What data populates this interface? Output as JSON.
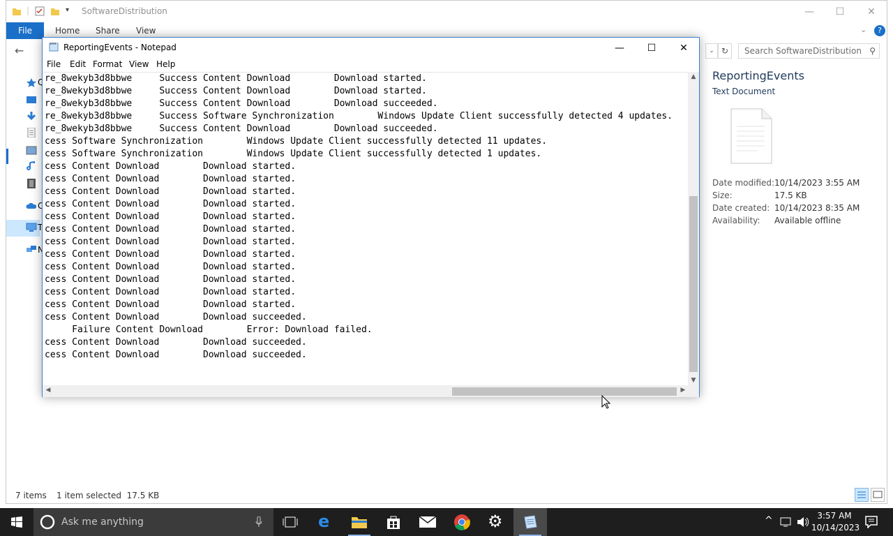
{
  "explorer": {
    "title": "SoftwareDistribution",
    "ribbon": {
      "file": "File",
      "tabs": [
        "Home",
        "Share",
        "View"
      ]
    },
    "search_placeholder": "Search SoftwareDistribution",
    "sidebar_letters": [
      "Q",
      "C",
      "T",
      "N"
    ],
    "details": {
      "name": "ReportingEvents",
      "type": "Text Document",
      "rows": [
        {
          "label": "Date modified:",
          "value": "10/14/2023 3:55 AM"
        },
        {
          "label": "Size:",
          "value": "17.5 KB"
        },
        {
          "label": "Date created:",
          "value": "10/14/2023 8:35 AM"
        },
        {
          "label": "Availability:",
          "value": "Available offline"
        }
      ]
    },
    "status": {
      "items": "7 items",
      "selected": "1 item selected  17.5 KB"
    }
  },
  "notepad": {
    "title": "ReportingEvents - Notepad",
    "menu": [
      "File",
      "Edit",
      "Format",
      "View",
      "Help"
    ],
    "lines": [
      "re_8wekyb3d8bbwe     Success Content Download        Download started.",
      "re_8wekyb3d8bbwe     Success Content Download        Download started.",
      "re_8wekyb3d8bbwe     Success Content Download        Download succeeded.",
      "re_8wekyb3d8bbwe     Success Software Synchronization        Windows Update Client successfully detected 4 updates.",
      "re_8wekyb3d8bbwe     Success Content Download        Download succeeded.",
      "cess Software Synchronization        Windows Update Client successfully detected 11 updates.",
      "cess Software Synchronization        Windows Update Client successfully detected 1 updates.",
      "cess Content Download        Download started.",
      "cess Content Download        Download started.",
      "cess Content Download        Download started.",
      "cess Content Download        Download started.",
      "cess Content Download        Download started.",
      "cess Content Download        Download started.",
      "cess Content Download        Download started.",
      "cess Content Download        Download started.",
      "cess Content Download        Download started.",
      "cess Content Download        Download started.",
      "cess Content Download        Download started.",
      "cess Content Download        Download started.",
      "cess Content Download        Download succeeded.",
      "     Failure Content Download        Error: Download failed.",
      "cess Content Download        Download succeeded.",
      "cess Content Download        Download succeeded."
    ]
  },
  "taskbar": {
    "search_text": "Ask me anything",
    "time": "3:57 AM",
    "date": "10/14/2023"
  },
  "colors": {
    "accent": "#1a6fc9",
    "taskbar": "#1e1e1e",
    "selection": "#cce8ff"
  }
}
